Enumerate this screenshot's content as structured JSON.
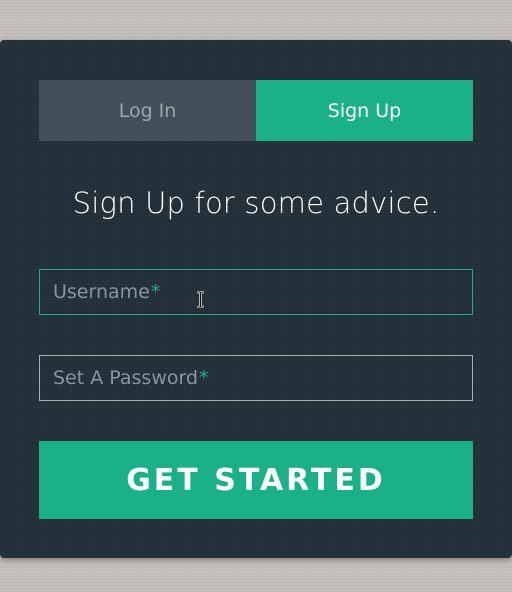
{
  "tabs": {
    "login_label": "Log In",
    "signup_label": "Sign Up",
    "active": "signup"
  },
  "form": {
    "heading": "Sign Up for some advice.",
    "username": {
      "label": "Username",
      "required_mark": "*",
      "value": ""
    },
    "password": {
      "label": "Set A Password",
      "required_mark": "*",
      "value": ""
    },
    "submit_label": "GET STARTED"
  },
  "colors": {
    "accent": "#1ab188",
    "panel_bg": "#24303a",
    "inactive_tab_bg": "#435059",
    "inactive_tab_text": "#9ba5ab",
    "page_bg": "#c2bfbc"
  },
  "icons": {
    "cursor": "text-cursor-icon"
  }
}
